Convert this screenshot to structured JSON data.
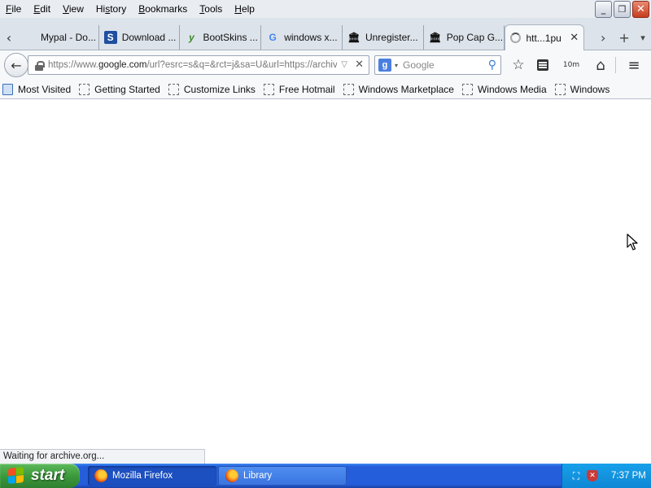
{
  "window": {
    "minimize_label": "_",
    "restore_label": "❐",
    "close_label": "✕"
  },
  "menubar": {
    "items": [
      {
        "label": "File",
        "access": "F"
      },
      {
        "label": "Edit",
        "access": "E"
      },
      {
        "label": "View",
        "access": "V"
      },
      {
        "label": "History",
        "access": "s"
      },
      {
        "label": "Bookmarks",
        "access": "B"
      },
      {
        "label": "Tools",
        "access": "T"
      },
      {
        "label": "Help",
        "access": "H"
      }
    ]
  },
  "tabs": {
    "scroll_left": "‹",
    "scroll_right": "›",
    "new_tab": "+",
    "list_all": "▾",
    "items": [
      {
        "label": "Mypal - Do...",
        "icon": "blank-icon",
        "selected": false
      },
      {
        "label": "Download ...",
        "icon": "download-site-icon",
        "selected": false
      },
      {
        "label": "BootSkins ...",
        "icon": "bootskins-icon",
        "selected": false
      },
      {
        "label": "windows x...",
        "icon": "google-icon",
        "selected": false
      },
      {
        "label": "Unregister...",
        "icon": "archive-icon",
        "selected": false
      },
      {
        "label": "Pop Cap G...",
        "icon": "archive-icon",
        "selected": false
      },
      {
        "label": "htt...1pu",
        "icon": "loading-icon",
        "selected": true
      }
    ]
  },
  "navbar": {
    "back": "←",
    "url_prefix": "https://www.",
    "url_domain": "google.com",
    "url_suffix": "/url?esrc=s&q=&rct=j&sa=U&url=https://archive",
    "url_dropdown": "▽",
    "url_clear": "✕",
    "search_engine_letter": "g",
    "search_dropdown": "▾",
    "search_placeholder": "Google",
    "search_glyph": "⚲",
    "star_glyph": "☆",
    "timer_label": "10m",
    "home_glyph": "⌂",
    "menu_glyph": "≡"
  },
  "bookmarks": [
    {
      "label": "Most Visited"
    },
    {
      "label": "Getting Started"
    },
    {
      "label": "Customize Links"
    },
    {
      "label": "Free Hotmail"
    },
    {
      "label": "Windows Marketplace"
    },
    {
      "label": "Windows Media"
    },
    {
      "label": "Windows"
    }
  ],
  "status": {
    "text": "Waiting for archive.org..."
  },
  "taskbar": {
    "start_label": "start",
    "tasks": [
      {
        "label": "Mozilla Firefox",
        "active": true
      },
      {
        "label": "Library",
        "active": false
      }
    ],
    "clock": "7:37 PM"
  },
  "colors": {
    "taskbar_blue": "#245edb",
    "start_green": "#3c9a3c",
    "tray_blue": "#0f87d4",
    "xp_flag": [
      "#f25022",
      "#7fba00",
      "#00a4ef",
      "#ffb900"
    ]
  }
}
